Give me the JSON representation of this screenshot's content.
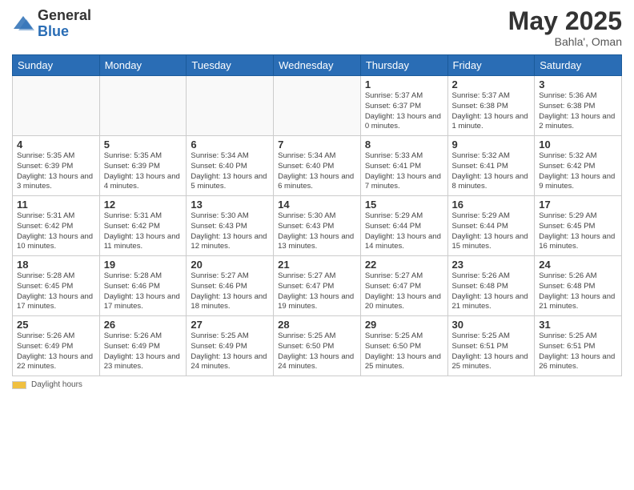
{
  "header": {
    "logo_general": "General",
    "logo_blue": "Blue",
    "month": "May 2025",
    "location": "Bahla', Oman"
  },
  "days_of_week": [
    "Sunday",
    "Monday",
    "Tuesday",
    "Wednesday",
    "Thursday",
    "Friday",
    "Saturday"
  ],
  "weeks": [
    [
      {
        "day": "",
        "info": ""
      },
      {
        "day": "",
        "info": ""
      },
      {
        "day": "",
        "info": ""
      },
      {
        "day": "",
        "info": ""
      },
      {
        "day": "1",
        "info": "Sunrise: 5:37 AM\nSunset: 6:37 PM\nDaylight: 13 hours and 0 minutes."
      },
      {
        "day": "2",
        "info": "Sunrise: 5:37 AM\nSunset: 6:38 PM\nDaylight: 13 hours and 1 minute."
      },
      {
        "day": "3",
        "info": "Sunrise: 5:36 AM\nSunset: 6:38 PM\nDaylight: 13 hours and 2 minutes."
      }
    ],
    [
      {
        "day": "4",
        "info": "Sunrise: 5:35 AM\nSunset: 6:39 PM\nDaylight: 13 hours and 3 minutes."
      },
      {
        "day": "5",
        "info": "Sunrise: 5:35 AM\nSunset: 6:39 PM\nDaylight: 13 hours and 4 minutes."
      },
      {
        "day": "6",
        "info": "Sunrise: 5:34 AM\nSunset: 6:40 PM\nDaylight: 13 hours and 5 minutes."
      },
      {
        "day": "7",
        "info": "Sunrise: 5:34 AM\nSunset: 6:40 PM\nDaylight: 13 hours and 6 minutes."
      },
      {
        "day": "8",
        "info": "Sunrise: 5:33 AM\nSunset: 6:41 PM\nDaylight: 13 hours and 7 minutes."
      },
      {
        "day": "9",
        "info": "Sunrise: 5:32 AM\nSunset: 6:41 PM\nDaylight: 13 hours and 8 minutes."
      },
      {
        "day": "10",
        "info": "Sunrise: 5:32 AM\nSunset: 6:42 PM\nDaylight: 13 hours and 9 minutes."
      }
    ],
    [
      {
        "day": "11",
        "info": "Sunrise: 5:31 AM\nSunset: 6:42 PM\nDaylight: 13 hours and 10 minutes."
      },
      {
        "day": "12",
        "info": "Sunrise: 5:31 AM\nSunset: 6:42 PM\nDaylight: 13 hours and 11 minutes."
      },
      {
        "day": "13",
        "info": "Sunrise: 5:30 AM\nSunset: 6:43 PM\nDaylight: 13 hours and 12 minutes."
      },
      {
        "day": "14",
        "info": "Sunrise: 5:30 AM\nSunset: 6:43 PM\nDaylight: 13 hours and 13 minutes."
      },
      {
        "day": "15",
        "info": "Sunrise: 5:29 AM\nSunset: 6:44 PM\nDaylight: 13 hours and 14 minutes."
      },
      {
        "day": "16",
        "info": "Sunrise: 5:29 AM\nSunset: 6:44 PM\nDaylight: 13 hours and 15 minutes."
      },
      {
        "day": "17",
        "info": "Sunrise: 5:29 AM\nSunset: 6:45 PM\nDaylight: 13 hours and 16 minutes."
      }
    ],
    [
      {
        "day": "18",
        "info": "Sunrise: 5:28 AM\nSunset: 6:45 PM\nDaylight: 13 hours and 17 minutes."
      },
      {
        "day": "19",
        "info": "Sunrise: 5:28 AM\nSunset: 6:46 PM\nDaylight: 13 hours and 17 minutes."
      },
      {
        "day": "20",
        "info": "Sunrise: 5:27 AM\nSunset: 6:46 PM\nDaylight: 13 hours and 18 minutes."
      },
      {
        "day": "21",
        "info": "Sunrise: 5:27 AM\nSunset: 6:47 PM\nDaylight: 13 hours and 19 minutes."
      },
      {
        "day": "22",
        "info": "Sunrise: 5:27 AM\nSunset: 6:47 PM\nDaylight: 13 hours and 20 minutes."
      },
      {
        "day": "23",
        "info": "Sunrise: 5:26 AM\nSunset: 6:48 PM\nDaylight: 13 hours and 21 minutes."
      },
      {
        "day": "24",
        "info": "Sunrise: 5:26 AM\nSunset: 6:48 PM\nDaylight: 13 hours and 21 minutes."
      }
    ],
    [
      {
        "day": "25",
        "info": "Sunrise: 5:26 AM\nSunset: 6:49 PM\nDaylight: 13 hours and 22 minutes."
      },
      {
        "day": "26",
        "info": "Sunrise: 5:26 AM\nSunset: 6:49 PM\nDaylight: 13 hours and 23 minutes."
      },
      {
        "day": "27",
        "info": "Sunrise: 5:25 AM\nSunset: 6:49 PM\nDaylight: 13 hours and 24 minutes."
      },
      {
        "day": "28",
        "info": "Sunrise: 5:25 AM\nSunset: 6:50 PM\nDaylight: 13 hours and 24 minutes."
      },
      {
        "day": "29",
        "info": "Sunrise: 5:25 AM\nSunset: 6:50 PM\nDaylight: 13 hours and 25 minutes."
      },
      {
        "day": "30",
        "info": "Sunrise: 5:25 AM\nSunset: 6:51 PM\nDaylight: 13 hours and 25 minutes."
      },
      {
        "day": "31",
        "info": "Sunrise: 5:25 AM\nSunset: 6:51 PM\nDaylight: 13 hours and 26 minutes."
      }
    ]
  ],
  "footer": {
    "swatch_label": "Daylight hours"
  }
}
